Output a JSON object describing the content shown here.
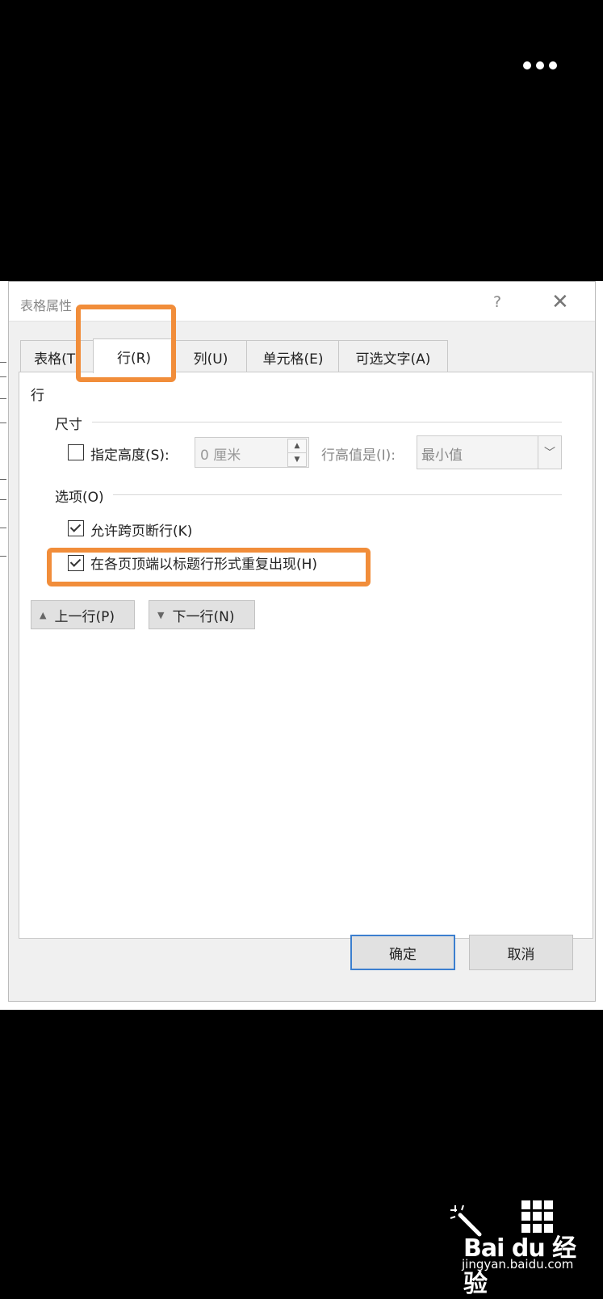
{
  "dialog": {
    "title": "表格属性",
    "help": "?",
    "close": "✕"
  },
  "tabs": [
    "表格(T)",
    "行(R)",
    "列(U)",
    "单元格(E)",
    "可选文字(A)"
  ],
  "active_tab": "行(R)",
  "panel": {
    "section_title": "行",
    "size_group": "尺寸",
    "specify_height_label": "指定高度(S):",
    "specify_height_checked": false,
    "height_value": "0 厘米",
    "row_height_is_label": "行高值是(I):",
    "row_height_mode": "最小值",
    "options_group": "选项(O)",
    "allow_break_label": "允许跨页断行(K)",
    "allow_break_checked": true,
    "repeat_header_label": "在各页顶端以标题行形式重复出现(H)",
    "repeat_header_checked": true,
    "prev_row": "上一行(P)",
    "next_row": "下一行(N)"
  },
  "footer": {
    "ok": "确定",
    "cancel": "取消"
  },
  "watermark": {
    "logo": "Bai du 经验",
    "url": "jingyan.baidu.com"
  },
  "colors": {
    "highlight": "#f18d3a",
    "ok_border": "#3c7fcf"
  }
}
